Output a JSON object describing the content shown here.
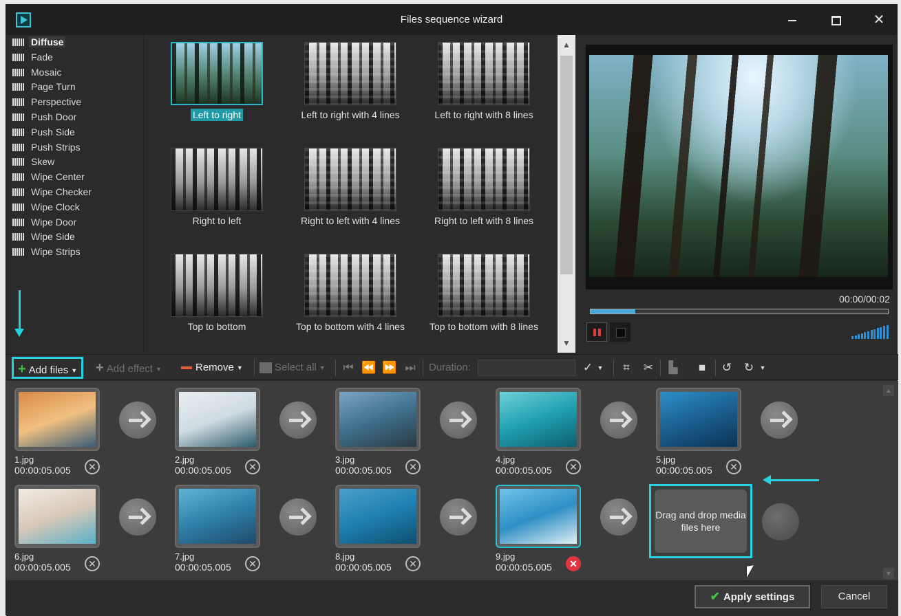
{
  "window": {
    "title": "Files sequence wizard",
    "controls": {
      "minimize": "minimize",
      "maximize": "maximize",
      "close": "✕"
    }
  },
  "effects_list": [
    {
      "label": "Diffuse",
      "selected": true
    },
    {
      "label": "Fade"
    },
    {
      "label": "Mosaic"
    },
    {
      "label": "Page Turn"
    },
    {
      "label": "Perspective"
    },
    {
      "label": "Push Door"
    },
    {
      "label": "Push Side"
    },
    {
      "label": "Push Strips"
    },
    {
      "label": "Skew"
    },
    {
      "label": "Wipe Center"
    },
    {
      "label": "Wipe Checker"
    },
    {
      "label": "Wipe Clock"
    },
    {
      "label": "Wipe Door"
    },
    {
      "label": "Wipe Side"
    },
    {
      "label": "Wipe Strips"
    }
  ],
  "transitions": [
    {
      "label": "Left to right",
      "selected": true
    },
    {
      "label": "Left to right with 4 lines"
    },
    {
      "label": "Left to right with 8 lines"
    },
    {
      "label": "Right to left"
    },
    {
      "label": "Right to left with 4 lines"
    },
    {
      "label": "Right to left with 8 lines"
    },
    {
      "label": "Top to bottom"
    },
    {
      "label": "Top to bottom with 4 lines"
    },
    {
      "label": "Top to bottom with 8 lines"
    }
  ],
  "preview": {
    "time": "00:00/00:02",
    "progress": 0.15
  },
  "toolbar": {
    "add_files": "Add files",
    "add_effect": "Add effect",
    "remove": "Remove",
    "select_all": "Select all",
    "duration_label": "Duration:",
    "duration_value": ""
  },
  "clips": [
    {
      "name": "1.jpg",
      "time": "00:00:05.005",
      "colors": [
        "#d98a4a",
        "#f0c080",
        "#3a5d7a"
      ]
    },
    {
      "name": "2.jpg",
      "time": "00:00:05.005",
      "colors": [
        "#e8eef2",
        "#cfdbe2",
        "#2b5b6b"
      ]
    },
    {
      "name": "3.jpg",
      "time": "00:00:05.005",
      "colors": [
        "#7aa6c4",
        "#3e6f8c",
        "#2b3b44"
      ]
    },
    {
      "name": "4.jpg",
      "time": "00:00:05.005",
      "colors": [
        "#6fd0d8",
        "#1f9fb1",
        "#0f5e6e"
      ]
    },
    {
      "name": "5.jpg",
      "time": "00:00:05.005",
      "colors": [
        "#2d8fc7",
        "#1b5e8f",
        "#0b3355"
      ]
    },
    {
      "name": "6.jpg",
      "time": "00:00:05.005",
      "colors": [
        "#f2ece4",
        "#d8c8b8",
        "#5ab0c8"
      ]
    },
    {
      "name": "7.jpg",
      "time": "00:00:05.005",
      "colors": [
        "#5fb5d6",
        "#2f7fa8",
        "#1f4a6a"
      ]
    },
    {
      "name": "8.jpg",
      "time": "00:00:05.005",
      "colors": [
        "#4aa0c8",
        "#1f7fb0",
        "#0f4f6f"
      ]
    },
    {
      "name": "9.jpg",
      "time": "00:00:05.005",
      "colors": [
        "#6fc3e8",
        "#2f8fc4",
        "#e0eef4"
      ],
      "selected": true
    }
  ],
  "drop_zone": {
    "text": "Drag and drop media files here"
  },
  "footer": {
    "apply": "Apply settings",
    "cancel": "Cancel"
  },
  "colors": {
    "accent": "#27d2e0",
    "selection": "#1f9aa6",
    "remove_active": "#e03540"
  }
}
